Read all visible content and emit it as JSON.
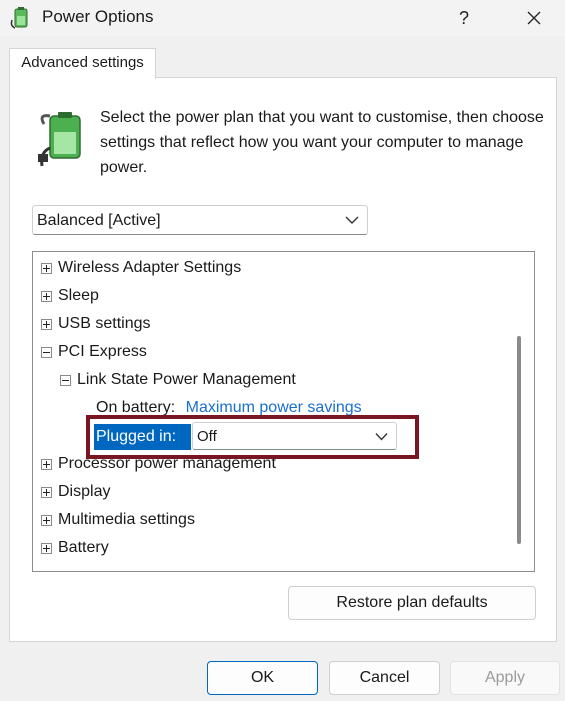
{
  "window": {
    "title": "Power Options",
    "help_label": "?",
    "icons": {
      "app": "power-options-icon",
      "close": "close-icon"
    }
  },
  "tab": {
    "label": "Advanced settings"
  },
  "description": "Select the power plan that you want to customise, then choose settings that reflect how you want your computer to manage power.",
  "plan_select": {
    "value": "Balanced [Active]"
  },
  "tree": {
    "items": [
      {
        "label": "Wireless Adapter Settings",
        "expanded": false
      },
      {
        "label": "Sleep",
        "expanded": false
      },
      {
        "label": "USB settings",
        "expanded": false
      },
      {
        "label": "PCI Express",
        "expanded": true
      },
      {
        "label": "Link State Power Management",
        "expanded": true
      },
      {
        "label": "On battery:",
        "value": "Maximum power savings"
      },
      {
        "label": "Plugged in:",
        "value": "Off"
      },
      {
        "label": "Processor power management",
        "expanded": false
      },
      {
        "label": "Display",
        "expanded": false
      },
      {
        "label": "Multimedia settings",
        "expanded": false
      },
      {
        "label": "Battery",
        "expanded": false
      }
    ]
  },
  "buttons": {
    "restore": "Restore plan defaults",
    "ok": "OK",
    "cancel": "Cancel",
    "apply": "Apply"
  },
  "colors": {
    "selection": "#0067c0",
    "link": "#1a6fd0",
    "highlight_box": "#7a1622"
  }
}
